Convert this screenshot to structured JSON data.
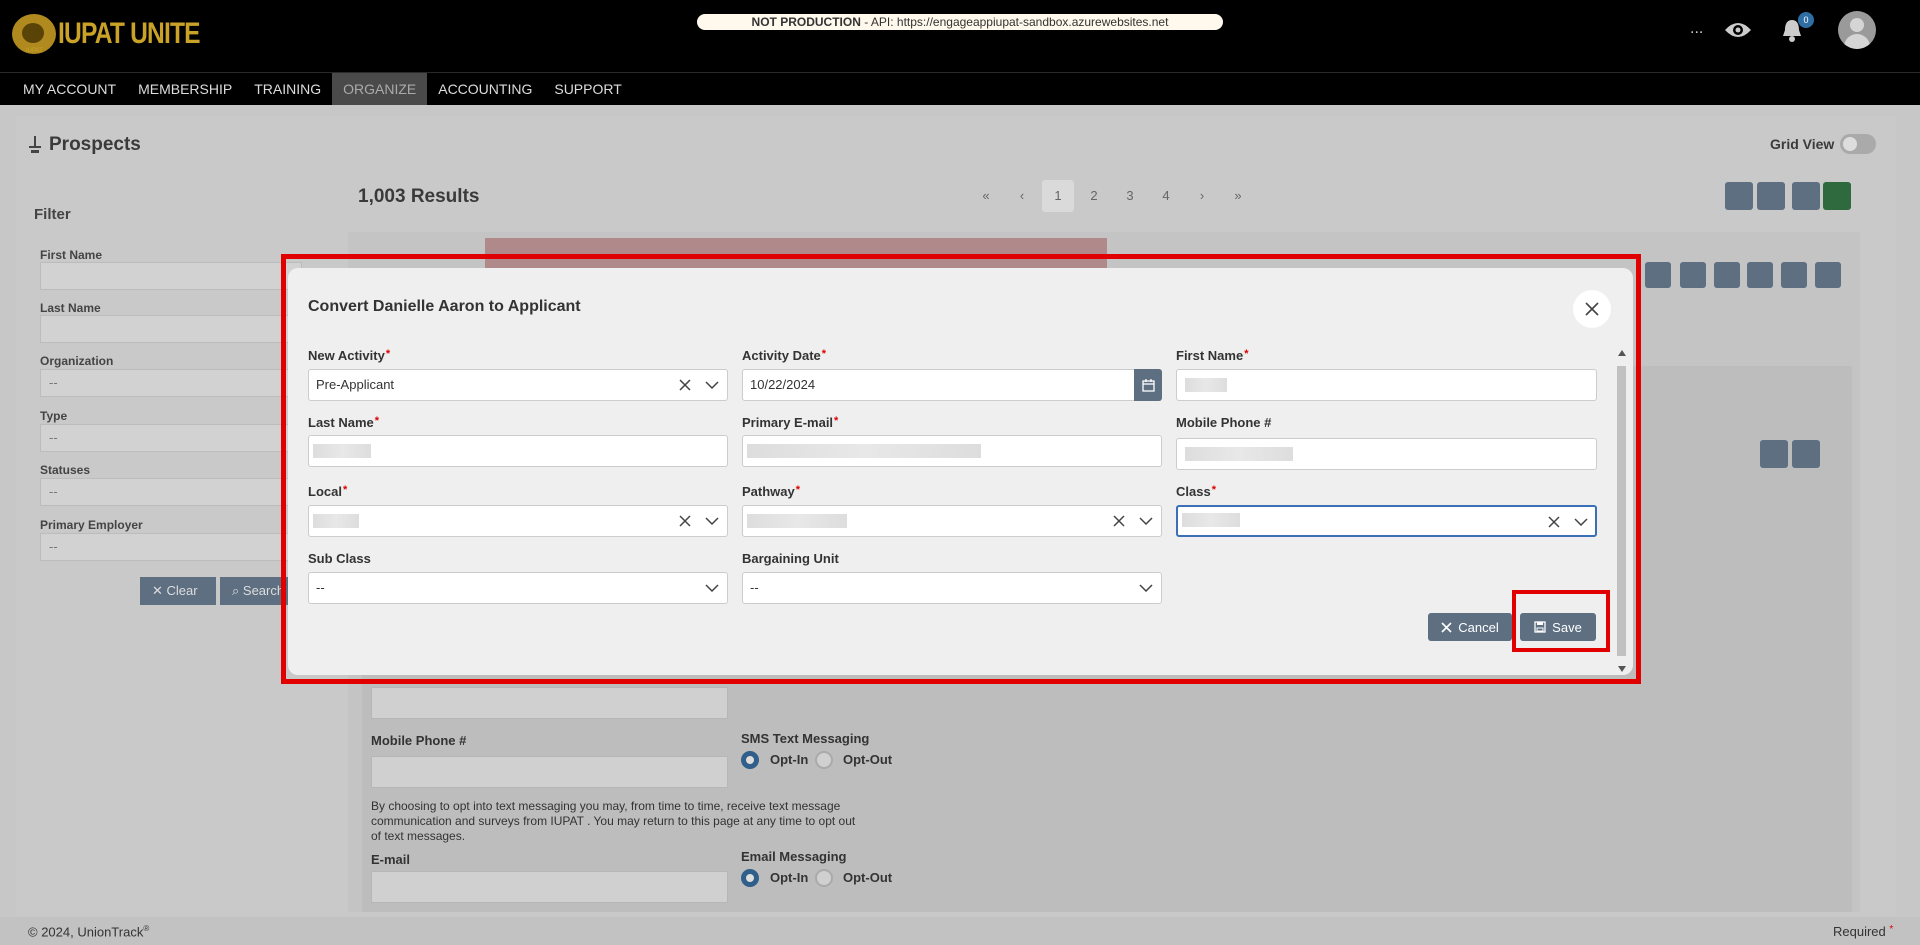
{
  "header": {
    "logo_text": "IUPAT UNITE",
    "logo_sub": "IUPAT",
    "env_label": "NOT PRODUCTION",
    "env_api": " - API: https://engageappiupat-sandbox.azurewebsites.net",
    "overflow_label": "...",
    "notification_count": "0"
  },
  "nav": {
    "items": [
      {
        "label": "MY ACCOUNT"
      },
      {
        "label": "MEMBERSHIP"
      },
      {
        "label": "TRAINING"
      },
      {
        "label": "ORGANIZE",
        "active": true
      },
      {
        "label": "ACCOUNTING"
      },
      {
        "label": "SUPPORT"
      }
    ]
  },
  "background": {
    "page_title": "Prospects",
    "grid_view_label": "Grid View",
    "filter_title": "Filter",
    "filters": [
      {
        "label": "First Name",
        "value": ""
      },
      {
        "label": "Last Name",
        "value": ""
      },
      {
        "label": "Organization",
        "value": "--"
      },
      {
        "label": "Type",
        "value": "--"
      },
      {
        "label": "Statuses",
        "value": "--"
      },
      {
        "label": "Primary Employer",
        "value": "--"
      }
    ],
    "clear_label": "Clear",
    "search_label": "Search",
    "results": "1,003 Results",
    "pages": [
      "1",
      "2",
      "3",
      "4"
    ],
    "mobile_label": "Mobile Phone #",
    "sms_label": "SMS Text Messaging",
    "opt_in": "Opt-In",
    "opt_out": "Opt-Out",
    "sms_disclaimer": "By choosing to opt into text messaging you may, from time to time, receive text message communication and surveys from IUPAT . You may return to this page at any time to opt out of text messages.",
    "email_label": "E-mail",
    "email_messaging_label": "Email Messaging"
  },
  "modal": {
    "title": "Convert Danielle Aaron to Applicant",
    "fields": {
      "new_activity": {
        "label": "New Activity",
        "value": "Pre-Applicant"
      },
      "activity_date": {
        "label": "Activity Date",
        "value": "10/22/2024"
      },
      "first_name": {
        "label": "First Name"
      },
      "last_name": {
        "label": "Last Name"
      },
      "primary_email": {
        "label": "Primary E-mail"
      },
      "mobile_phone": {
        "label": "Mobile Phone #"
      },
      "local": {
        "label": "Local"
      },
      "pathway": {
        "label": "Pathway"
      },
      "class": {
        "label": "Class"
      },
      "sub_class": {
        "label": "Sub Class",
        "value": "--"
      },
      "bargaining_unit": {
        "label": "Bargaining Unit",
        "value": "--"
      }
    },
    "required_mark": "*",
    "cancel_label": "Cancel",
    "save_label": "Save"
  },
  "footer": {
    "copyright": "© 2024, UnionTrack",
    "reg": "®",
    "required_label": "Required",
    "required_mark": "*"
  },
  "colors": {
    "accent": "#5e6f82",
    "highlight": "#e00000",
    "brand_gold": "#c9a227",
    "focus": "#3b6fb6"
  }
}
